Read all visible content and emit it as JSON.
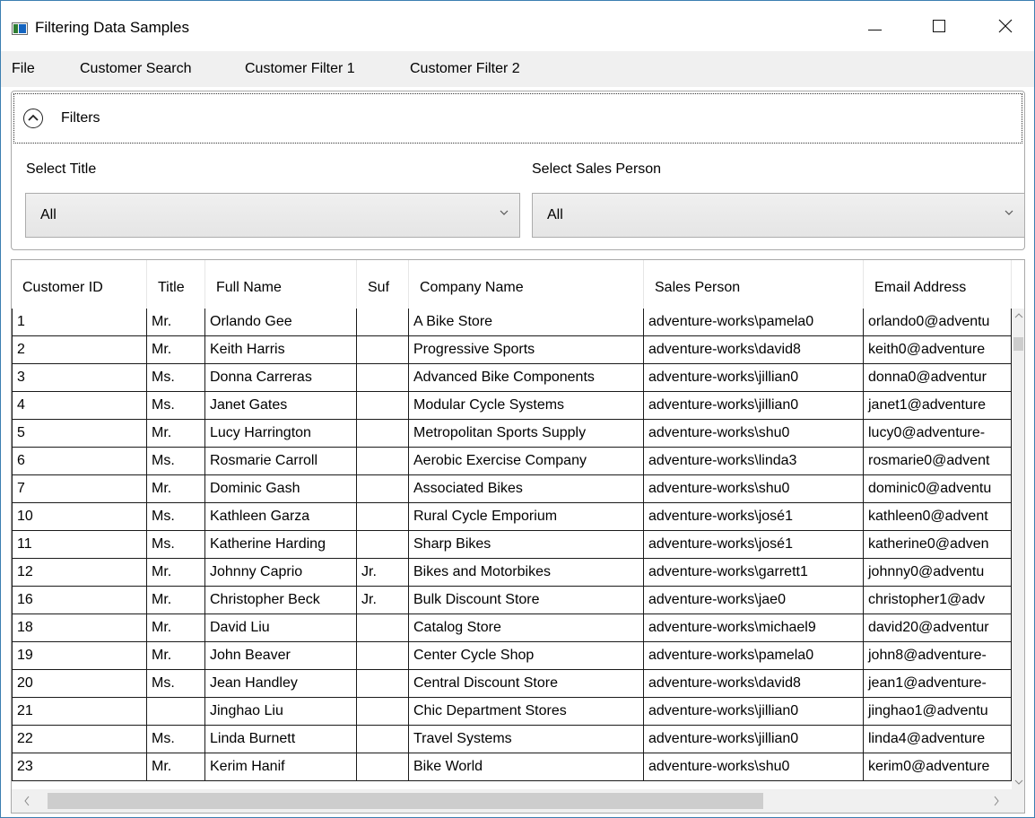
{
  "window": {
    "title": "Filtering Data Samples"
  },
  "menu": {
    "items": [
      "File",
      "Customer Search",
      "Customer Filter 1",
      "Customer Filter 2"
    ]
  },
  "filters": {
    "header": "Filters",
    "title_label": "Select Title",
    "title_value": "All",
    "sales_label": "Select Sales Person",
    "sales_value": "All"
  },
  "grid": {
    "columns": [
      "Customer ID",
      "Title",
      "Full Name",
      "Suf",
      "Company Name",
      "Sales Person",
      "Email Address"
    ],
    "rows": [
      [
        "1",
        "Mr.",
        "Orlando Gee",
        "",
        "A Bike Store",
        "adventure-works\\pamela0",
        "orlando0@adventu"
      ],
      [
        "2",
        "Mr.",
        "Keith Harris",
        "",
        "Progressive Sports",
        "adventure-works\\david8",
        "keith0@adventure"
      ],
      [
        "3",
        "Ms.",
        "Donna Carreras",
        "",
        "Advanced Bike Components",
        "adventure-works\\jillian0",
        "donna0@adventur"
      ],
      [
        "4",
        "Ms.",
        "Janet Gates",
        "",
        "Modular Cycle Systems",
        "adventure-works\\jillian0",
        "janet1@adventure"
      ],
      [
        "5",
        "Mr.",
        "Lucy Harrington",
        "",
        "Metropolitan Sports Supply",
        "adventure-works\\shu0",
        "lucy0@adventure-"
      ],
      [
        "6",
        "Ms.",
        "Rosmarie Carroll",
        "",
        "Aerobic Exercise Company",
        "adventure-works\\linda3",
        "rosmarie0@advent"
      ],
      [
        "7",
        "Mr.",
        "Dominic Gash",
        "",
        "Associated Bikes",
        "adventure-works\\shu0",
        "dominic0@adventu"
      ],
      [
        "10",
        "Ms.",
        "Kathleen Garza",
        "",
        "Rural Cycle Emporium",
        "adventure-works\\josé1",
        "kathleen0@advent"
      ],
      [
        "11",
        "Ms.",
        "Katherine Harding",
        "",
        "Sharp Bikes",
        "adventure-works\\josé1",
        "katherine0@adven"
      ],
      [
        "12",
        "Mr.",
        "Johnny Caprio",
        "Jr.",
        "Bikes and Motorbikes",
        "adventure-works\\garrett1",
        "johnny0@adventu"
      ],
      [
        "16",
        "Mr.",
        "Christopher Beck",
        "Jr.",
        "Bulk Discount Store",
        "adventure-works\\jae0",
        "christopher1@adv"
      ],
      [
        "18",
        "Mr.",
        "David Liu",
        "",
        "Catalog Store",
        "adventure-works\\michael9",
        "david20@adventur"
      ],
      [
        "19",
        "Mr.",
        "John Beaver",
        "",
        "Center Cycle Shop",
        "adventure-works\\pamela0",
        "john8@adventure-"
      ],
      [
        "20",
        "Ms.",
        "Jean Handley",
        "",
        "Central Discount Store",
        "adventure-works\\david8",
        "jean1@adventure-"
      ],
      [
        "21",
        "",
        "Jinghao Liu",
        "",
        "Chic Department Stores",
        "adventure-works\\jillian0",
        "jinghao1@adventu"
      ],
      [
        "22",
        "Ms.",
        "Linda Burnett",
        "",
        "Travel Systems",
        "adventure-works\\jillian0",
        "linda4@adventure"
      ],
      [
        "23",
        "Mr.",
        "Kerim Hanif",
        "",
        "Bike World",
        "adventure-works\\shu0",
        "kerim0@adventure"
      ]
    ]
  },
  "icons": {
    "collapse": "chevron-up-circle-icon",
    "combo_arrow": "chevron-down-icon"
  },
  "colors": {
    "window_border": "#3c7fb1",
    "menubar": "#f0f0f0",
    "grid_lines": "#1a1a1a"
  }
}
